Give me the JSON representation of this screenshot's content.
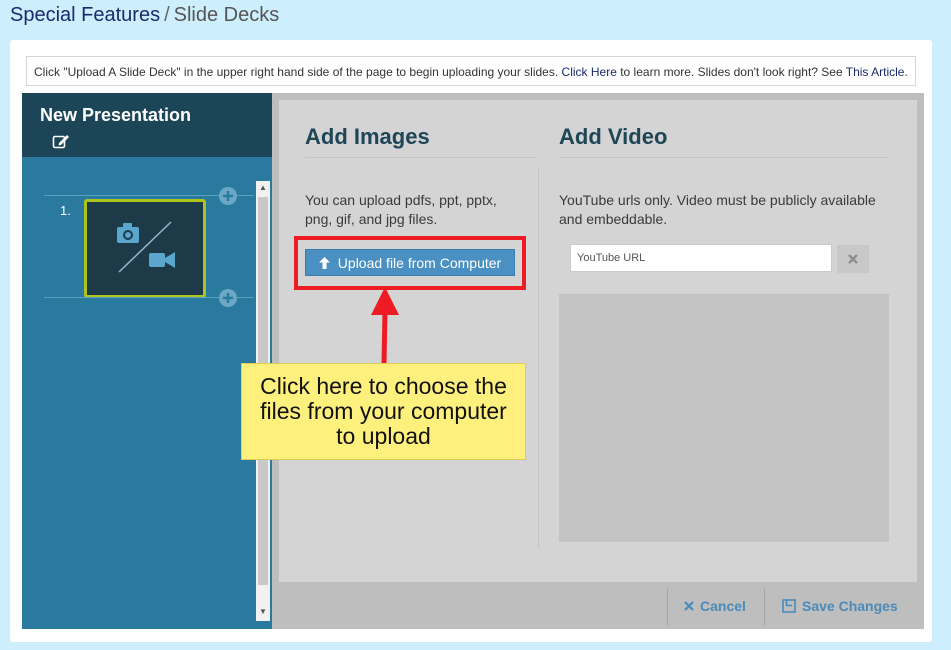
{
  "breadcrumb": {
    "parent": "Special Features",
    "separator": "/",
    "current": "Slide Decks"
  },
  "info_bar": {
    "text_before": "Click \"Upload A Slide Deck\" in the upper right hand side of the page to begin uploading your slides.",
    "link1": "Click Here",
    "text_middle": "to learn more. Slides don't look right? See",
    "link2": "This Article",
    "text_end": "."
  },
  "sidebar": {
    "title": "New Presentation",
    "slides": [
      {
        "number": "1."
      }
    ]
  },
  "add_images": {
    "title": "Add Images",
    "description": "You can upload pdfs, ppt, pptx, png, gif, and jpg files.",
    "upload_button_label": "Upload file from Computer"
  },
  "add_video": {
    "title": "Add Video",
    "description": "YouTube urls only. Video must be publicly available and embeddable.",
    "input_placeholder": "YouTube URL",
    "input_value": ""
  },
  "footer": {
    "cancel_label": "Cancel",
    "save_label": "Save Changes"
  },
  "callout": {
    "text": "Click here to choose the files from your computer to upload"
  },
  "colors": {
    "accent": "#4a90c2",
    "sidebar": "#2a7a9f",
    "highlight": "#ee1b24",
    "callout": "#fef07c"
  }
}
